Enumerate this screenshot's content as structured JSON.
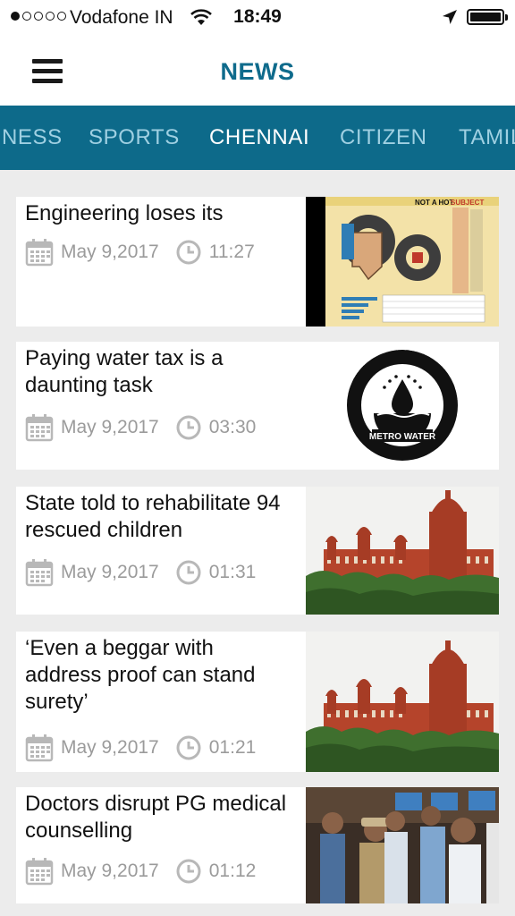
{
  "status": {
    "carrier": "Vodafone IN",
    "time": "18:49",
    "signal_dots": [
      "filled",
      "empty",
      "empty",
      "empty",
      "empty"
    ]
  },
  "header": {
    "title": "NEWS",
    "menu_icon": "hamburger-menu-icon"
  },
  "tabs": [
    {
      "label": "NESS",
      "active": false
    },
    {
      "label": "SPORTS",
      "active": false
    },
    {
      "label": "CHENNAI",
      "active": true
    },
    {
      "label": "CITIZEN",
      "active": false
    },
    {
      "label": "TAMIL",
      "active": false
    }
  ],
  "articles": [
    {
      "title": "Engineering loses its",
      "date": "May 9,2017",
      "time": "11:27",
      "image": "infographic"
    },
    {
      "title": "Paying water tax is a daunting task",
      "date": "May 9,2017",
      "time": "03:30",
      "image": "metro-water-logo"
    },
    {
      "title": "State told to rehabilitate 94 rescued children",
      "date": "May 9,2017",
      "time": "01:31",
      "image": "high-court-building"
    },
    {
      "title": "‘Even a beggar with address proof can stand surety’",
      "date": "May 9,2017",
      "time": "01:21",
      "image": "high-court-building"
    },
    {
      "title": "Doctors disrupt PG medical counselling",
      "date": "May 9,2017",
      "time": "01:12",
      "image": "police-and-doctors-photo"
    }
  ],
  "thumb_text": {
    "infographic_heading_1": "NOT A HOT",
    "infographic_heading_2": "SUBJECT",
    "metro_ring": "CHENNAI METROPOLITAN WATER SUPPLY AND SEWERAGE BOARD",
    "metro_label": "METRO WATER"
  },
  "colors": {
    "accent": "#0f6b8c",
    "tab_bar": "#0d6a8a",
    "tab_inactive": "#9fd0e2",
    "meta_gray": "#9b9b9b",
    "feed_bg": "#ececec"
  }
}
